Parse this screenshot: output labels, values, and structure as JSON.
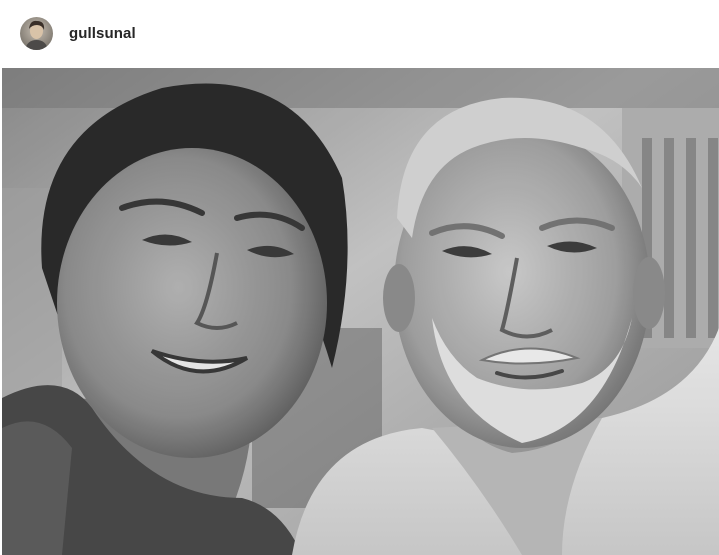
{
  "post": {
    "username": "gullsunal",
    "avatar_icon": "profile-avatar",
    "photo": {
      "kind": "black-and-white portrait of a woman and a bearded man",
      "tone": "grayscale"
    }
  },
  "colors": {
    "background": "#ffffff",
    "username_text": "#262626"
  }
}
